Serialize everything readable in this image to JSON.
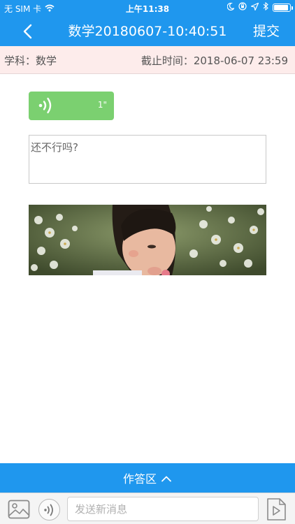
{
  "status_bar": {
    "carrier": "无 SIM 卡",
    "time": "上午11:38"
  },
  "nav": {
    "title": "数学20180607-10:40:51",
    "submit_label": "提交"
  },
  "info": {
    "subject": "学科：数学",
    "deadline": "截止时间：2018-06-07 23:59"
  },
  "voice_message": {
    "duration": "1\""
  },
  "answer_text": "还不行吗?",
  "answer_area": {
    "label": "作答区"
  },
  "composer": {
    "placeholder": "发送新消息",
    "value": ""
  },
  "colors": {
    "header": "#1f97ee",
    "info_bar": "#fdeceb",
    "voice_bubble": "#7bd070"
  }
}
